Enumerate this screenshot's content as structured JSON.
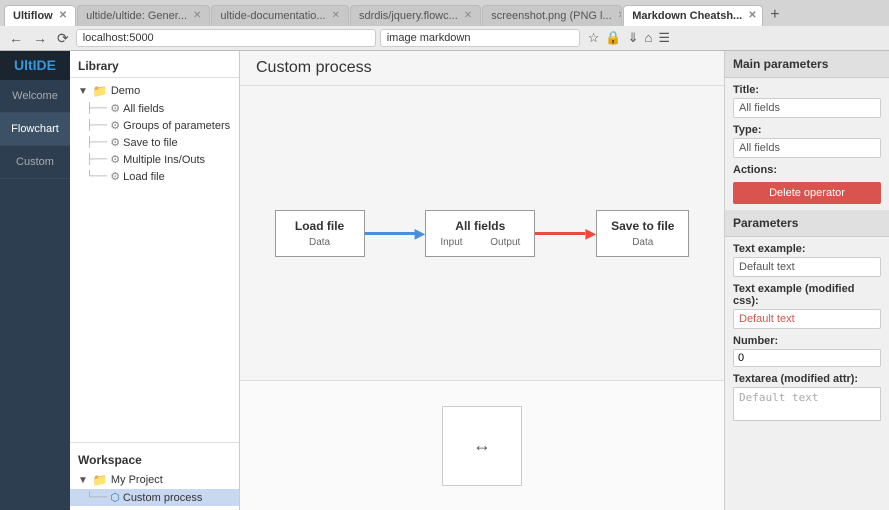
{
  "browser": {
    "tabs": [
      {
        "label": "Ultiflow",
        "active": true
      },
      {
        "label": "ultide/ultide: Gener...",
        "active": false
      },
      {
        "label": "ultide-documentatio...",
        "active": false
      },
      {
        "label": "sdrdis/jquery.flowc...",
        "active": false
      },
      {
        "label": "screenshot.png (PNG l...",
        "active": false
      },
      {
        "label": "Markdown Cheatsh...",
        "active": false
      }
    ],
    "address": "localhost:5000",
    "search": "image markdown"
  },
  "sidebar": {
    "logo": "UltIDE",
    "items": [
      {
        "label": "Welcome",
        "active": false,
        "highlight": false
      },
      {
        "label": "Flowchart",
        "active": true,
        "highlight": false
      },
      {
        "label": "Custom",
        "active": false,
        "highlight": false
      }
    ]
  },
  "library": {
    "title": "Library",
    "tree": {
      "demo_label": "Demo",
      "items": [
        {
          "label": "All fields",
          "indent": 2
        },
        {
          "label": "Groups of parameters",
          "indent": 2
        },
        {
          "label": "Save to file",
          "indent": 2
        },
        {
          "label": "Multiple Ins/Outs",
          "indent": 2
        },
        {
          "label": "Load file",
          "indent": 2
        }
      ]
    }
  },
  "workspace": {
    "title": "Workspace",
    "project": "My Project",
    "selected": "Custom process"
  },
  "main": {
    "title": "Custom process",
    "nodes": [
      {
        "label": "Load file",
        "port_label": "Data"
      },
      {
        "label": "All fields",
        "port_in": "Input",
        "port_out": "Output"
      },
      {
        "label": "Save to file",
        "port_label": "Data"
      }
    ]
  },
  "right_panel": {
    "main_params_title": "Main parameters",
    "title_label": "Title:",
    "title_value": "All fields",
    "type_label": "Type:",
    "type_value": "All fields",
    "actions_label": "Actions:",
    "delete_btn": "Delete operator",
    "params_title": "Parameters",
    "text_example_label": "Text example:",
    "text_example_value": "Default text",
    "text_example_css_label": "Text example (modified css):",
    "text_example_css_value": "Default text",
    "number_label": "Number:",
    "number_value": "0",
    "textarea_label": "Textarea (modified attr):",
    "textarea_value": "Default text"
  }
}
